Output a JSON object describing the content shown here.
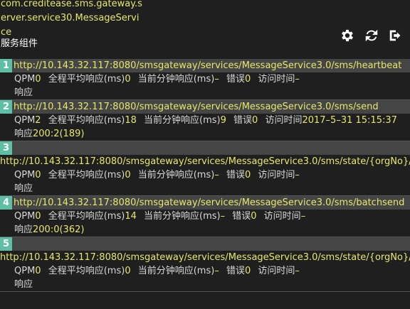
{
  "header": {
    "service_name": "com.creditease.sms.gateway.server.service30.MessageService",
    "service_type": "服务组件",
    "icons": [
      "gear-icon",
      "refresh-icon",
      "exit-icon"
    ]
  },
  "labels": {
    "qpm": "QPM",
    "avg_resp": "全程平均响应(ms)",
    "cur_resp": "当前分钟响应(ms)",
    "errors": "错误",
    "access_time": "访问时间",
    "response": "响应"
  },
  "entries": [
    {
      "index": "1",
      "url": "http://10.143.32.117:8080/smsgateway/services/MessageService3.0/sms/heartbeat",
      "qpm": "0",
      "avg_resp": "0",
      "cur_resp": "–",
      "errors": "0",
      "access_time": "–",
      "response": ""
    },
    {
      "index": "2",
      "url": "http://10.143.32.117:8080/smsgateway/services/MessageService3.0/sms/send",
      "qpm": "2",
      "avg_resp": "18",
      "cur_resp": "9",
      "errors": "0",
      "access_time": "2017–5–31 15:15:37",
      "response": "200:2(189)"
    },
    {
      "index": "3",
      "url": "http://10.143.32.117:8080/smsgateway/services/MessageService3.0/sms/state/{orgNo}/",
      "qpm": "0",
      "avg_resp": "0",
      "cur_resp": "–",
      "errors": "0",
      "access_time": "–",
      "response": ""
    },
    {
      "index": "4",
      "url": "http://10.143.32.117:8080/smsgateway/services/MessageService3.0/sms/batchsend",
      "qpm": "0",
      "avg_resp": "14",
      "cur_resp": "–",
      "errors": "0",
      "access_time": "–",
      "response": "200:0(362)"
    },
    {
      "index": "5",
      "url": "http://10.143.32.117:8080/smsgateway/services/MessageService3.0/sms/state/{orgNo}/",
      "qpm": "0",
      "avg_resp": "0",
      "cur_resp": "–",
      "errors": "0",
      "access_time": "–",
      "response": ""
    }
  ]
}
